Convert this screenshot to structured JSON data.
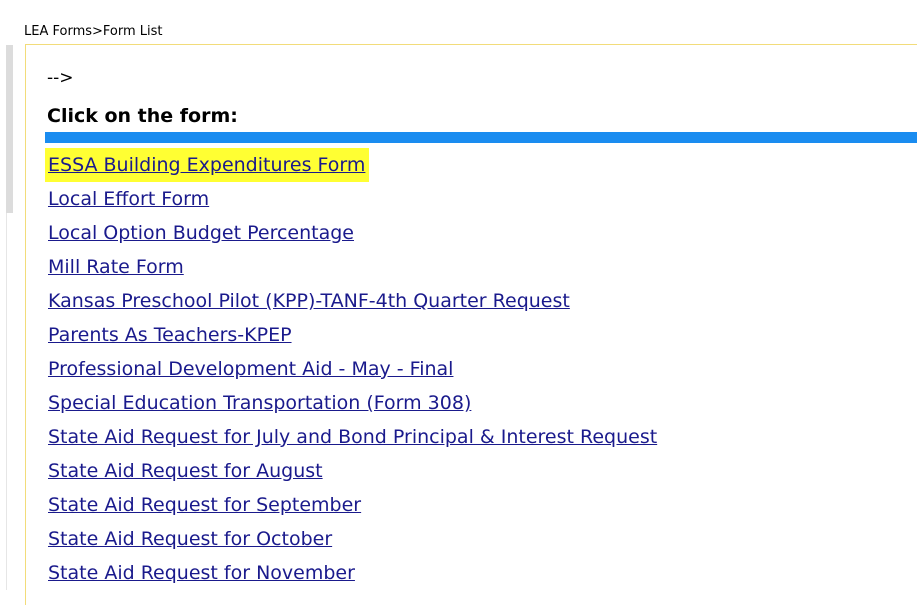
{
  "breadcrumb": "LEA Forms>Form List",
  "arrow_text": "-->",
  "heading": "Click on the form:",
  "colors": {
    "blue_bar": "#1a8cf0",
    "highlight": "#ffff33",
    "link": "#1a1a8c",
    "frame_border": "#f2dc7a"
  },
  "forms": [
    {
      "label": "ESSA Building Expenditures Form",
      "highlighted": true
    },
    {
      "label": "Local Effort Form"
    },
    {
      "label": "Local Option Budget Percentage"
    },
    {
      "label": "Mill Rate Form"
    },
    {
      "label": "Kansas Preschool Pilot (KPP)-TANF-4th Quarter Request"
    },
    {
      "label": "Parents As Teachers-KPEP"
    },
    {
      "label": "Professional Development Aid - May - Final"
    },
    {
      "label": "Special Education Transportation (Form 308)"
    },
    {
      "label": "State Aid Request for July and Bond Principal & Interest Request"
    },
    {
      "label": "State Aid Request for August"
    },
    {
      "label": "State Aid Request for September"
    },
    {
      "label": "State Aid Request for October"
    },
    {
      "label": "State Aid Request for November"
    }
  ]
}
